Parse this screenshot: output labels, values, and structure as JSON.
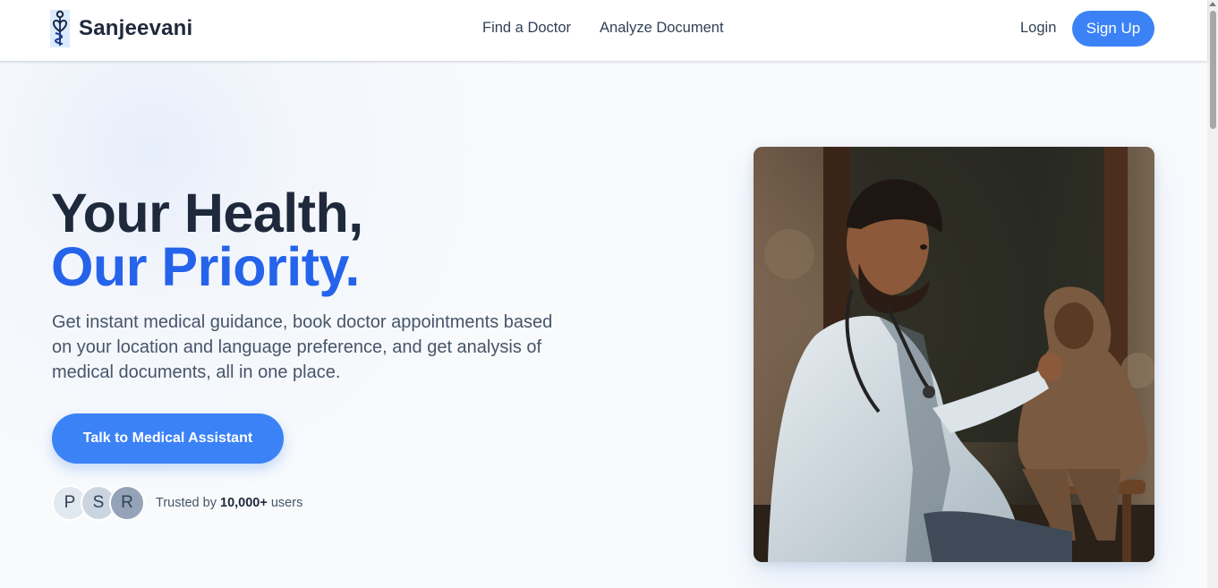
{
  "header": {
    "brand": "Sanjeevani",
    "logo_icon": "caduceus-icon",
    "nav": [
      {
        "label": "Find a Doctor"
      },
      {
        "label": "Analyze Document"
      }
    ],
    "login_label": "Login",
    "signup_label": "Sign Up"
  },
  "hero": {
    "headline_line1": "Your Health,",
    "headline_line2": "Our Priority.",
    "subtitle": "Get instant medical guidance, book doctor appointments based on your location and language preference, and get analysis of medical documents, all in one place.",
    "cta_label": "Talk to Medical Assistant",
    "avatars": [
      "P",
      "S",
      "R"
    ],
    "trusted_prefix": "Trusted by",
    "trusted_count": "10,000+",
    "trusted_suffix": "users"
  },
  "colors": {
    "accent": "#3b82f6",
    "headline_accent": "#2563eb",
    "text_dark": "#1e293b"
  }
}
